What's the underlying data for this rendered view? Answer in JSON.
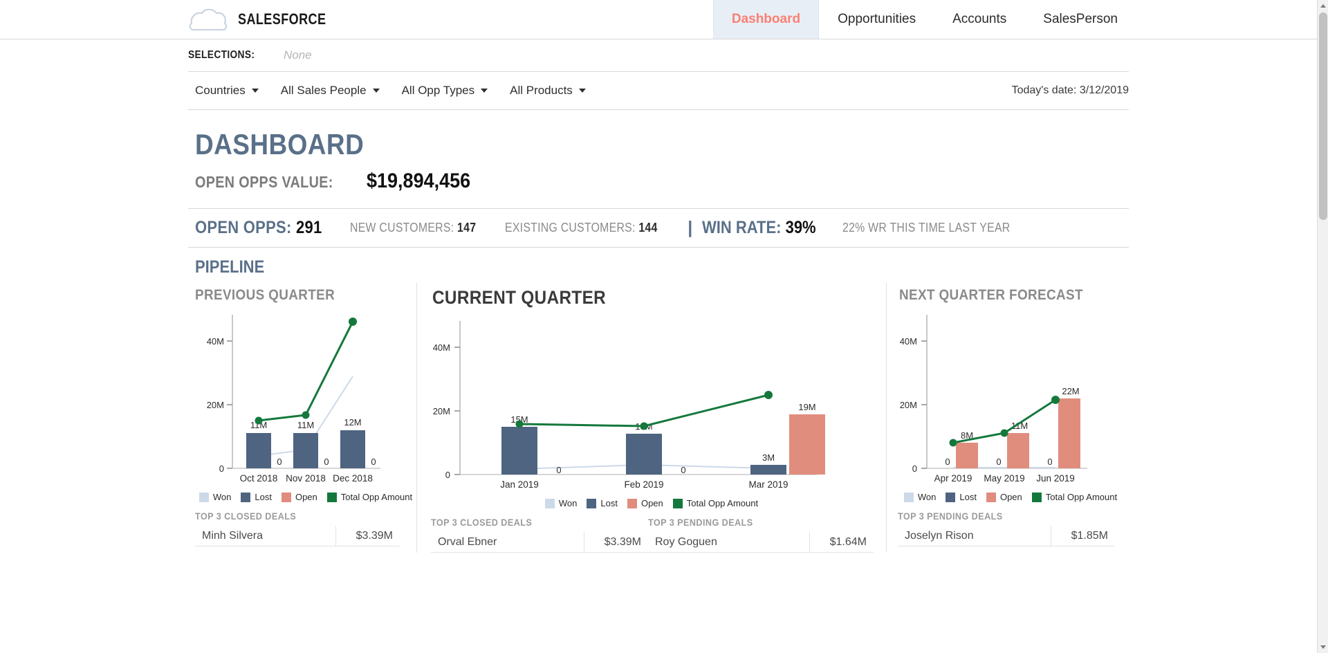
{
  "header": {
    "brand": "SALESFORCE",
    "logo_icon": "cloud-icon",
    "tabs": [
      {
        "label": "Dashboard",
        "active": true
      },
      {
        "label": "Opportunities",
        "active": false
      },
      {
        "label": "Accounts",
        "active": false
      },
      {
        "label": "SalesPerson",
        "active": false
      }
    ],
    "accent_color": "#fa8072",
    "active_tab_bg": "#e8eef5"
  },
  "selections": {
    "label": "SELECTIONS:",
    "value": "None"
  },
  "filters": {
    "items": [
      {
        "label": "Countries",
        "icon": "chevron-down-icon"
      },
      {
        "label": "All Sales People",
        "icon": "chevron-down-icon"
      },
      {
        "label": "All Opp Types",
        "icon": "chevron-down-icon"
      },
      {
        "label": "All Products",
        "icon": "chevron-down-icon"
      }
    ],
    "today": "Today's date: 3/12/2019"
  },
  "dashboard": {
    "title": "DASHBOARD",
    "open_opps_value_label": "OPEN OPPS VALUE:",
    "open_opps_value": "$19,894,456",
    "title_color": "#5a7089"
  },
  "stats": {
    "open_opps_label": "OPEN OPPS:",
    "open_opps_value": "291",
    "new_customers_label": "NEW CUSTOMERS:",
    "new_customers_value": "147",
    "existing_customers_label": "EXISTING CUSTOMERS:",
    "existing_customers_value": "144",
    "divider": "|",
    "win_rate_label": "WIN RATE:",
    "win_rate_value": "39%",
    "last_year_note": "22% WR THIS TIME LAST YEAR"
  },
  "pipeline": {
    "heading": "PIPELINE"
  },
  "legend": {
    "items": [
      {
        "label": "Won",
        "color": "#ccd9e8"
      },
      {
        "label": "Lost",
        "color": "#4e6480"
      },
      {
        "label": "Open",
        "color": "#e08d7e"
      },
      {
        "label": "Total Opp Amount",
        "color": "#14783c"
      }
    ]
  },
  "panels": {
    "previous": {
      "title": "PREVIOUS QUARTER",
      "deals": {
        "heading": "TOP 3 CLOSED DEALS",
        "rows": [
          {
            "name": "Minh Silvera",
            "amount": "$3.39M"
          }
        ]
      }
    },
    "current": {
      "title": "CURRENT QUARTER",
      "closed_deals": {
        "heading": "TOP 3 CLOSED DEALS",
        "rows": [
          {
            "name": "Orval Ebner",
            "amount": "$3.39M"
          }
        ]
      },
      "pending_deals": {
        "heading": "TOP 3 PENDING DEALS",
        "rows": [
          {
            "name": "Roy Goguen",
            "amount": "$1.64M"
          }
        ]
      }
    },
    "next": {
      "title": "NEXT QUARTER FORECAST",
      "pending_deals": {
        "heading": "TOP 3 PENDING DEALS",
        "rows": [
          {
            "name": "Joselyn Rison",
            "amount": "$1.85M"
          }
        ]
      }
    }
  },
  "chart_data": [
    {
      "type": "bar",
      "id": "previous-quarter",
      "title": "PREVIOUS QUARTER",
      "categories": [
        "Oct 2018",
        "Nov 2018",
        "Dec 2018"
      ],
      "ylim": [
        0,
        48
      ],
      "yticks": [
        0,
        20,
        40
      ],
      "ytick_labels": [
        "0",
        "20M",
        "40M"
      ],
      "grid": false,
      "legend_position": "bottom",
      "series": [
        {
          "name": "Won",
          "type": "line",
          "color": "#ccd9e8",
          "values": [
            4,
            6,
            33
          ],
          "labels": [
            "",
            "",
            ""
          ]
        },
        {
          "name": "Lost",
          "type": "bar",
          "color": "#4e6480",
          "values": [
            11,
            11,
            12
          ],
          "labels": [
            "11M",
            "11M",
            "12M"
          ]
        },
        {
          "name": "Open",
          "type": "bar",
          "color": "#e08d7e",
          "values": [
            0,
            0,
            0
          ],
          "labels": [
            "0",
            "0",
            "0"
          ]
        },
        {
          "name": "Total Opp Amount",
          "type": "line",
          "color": "#14783c",
          "values": [
            15,
            17.5,
            46
          ],
          "labels": [
            "",
            "",
            ""
          ]
        }
      ]
    },
    {
      "type": "bar",
      "id": "current-quarter",
      "title": "CURRENT QUARTER",
      "categories": [
        "Jan 2019",
        "Feb 2019",
        "Mar 2019"
      ],
      "ylim": [
        0,
        48
      ],
      "yticks": [
        0,
        20,
        40
      ],
      "ytick_labels": [
        "0",
        "20M",
        "40M"
      ],
      "grid": false,
      "legend_position": "bottom",
      "series": [
        {
          "name": "Won",
          "type": "line",
          "color": "#ccd9e8",
          "values": [
            1.5,
            2.5,
            1.8
          ],
          "labels": [
            "",
            "",
            ""
          ]
        },
        {
          "name": "Lost",
          "type": "bar",
          "color": "#4e6480",
          "values": [
            15,
            13,
            3
          ],
          "labels": [
            "15M",
            "13M",
            "3M"
          ]
        },
        {
          "name": "Open",
          "type": "bar",
          "color": "#e08d7e",
          "values": [
            0,
            0,
            19
          ],
          "labels": [
            "0",
            "0",
            "19M"
          ]
        },
        {
          "name": "Total Opp Amount",
          "type": "line",
          "color": "#14783c",
          "values": [
            16,
            15.5,
            24
          ],
          "labels": [
            "",
            "",
            ""
          ]
        }
      ]
    },
    {
      "type": "bar",
      "id": "next-quarter-forecast",
      "title": "NEXT QUARTER FORECAST",
      "categories": [
        "Apr 2019",
        "May 2019",
        "Jun 2019"
      ],
      "ylim": [
        0,
        48
      ],
      "yticks": [
        0,
        20,
        40
      ],
      "ytick_labels": [
        "0",
        "20M",
        "40M"
      ],
      "grid": false,
      "legend_position": "bottom",
      "series": [
        {
          "name": "Won",
          "type": "line",
          "color": "#ccd9e8",
          "values": [
            0,
            0,
            0
          ],
          "labels": [
            "",
            "",
            ""
          ]
        },
        {
          "name": "Lost",
          "type": "bar",
          "color": "#4e6480",
          "values": [
            0,
            0,
            0
          ],
          "labels": [
            "0",
            "0",
            "0"
          ]
        },
        {
          "name": "Open",
          "type": "bar",
          "color": "#e08d7e",
          "values": [
            8,
            11,
            22
          ],
          "labels": [
            "8M",
            "11M",
            "22M"
          ]
        },
        {
          "name": "Total Opp Amount",
          "type": "line",
          "color": "#14783c",
          "values": [
            8,
            11,
            22
          ],
          "labels": [
            "",
            "",
            ""
          ]
        }
      ]
    }
  ]
}
